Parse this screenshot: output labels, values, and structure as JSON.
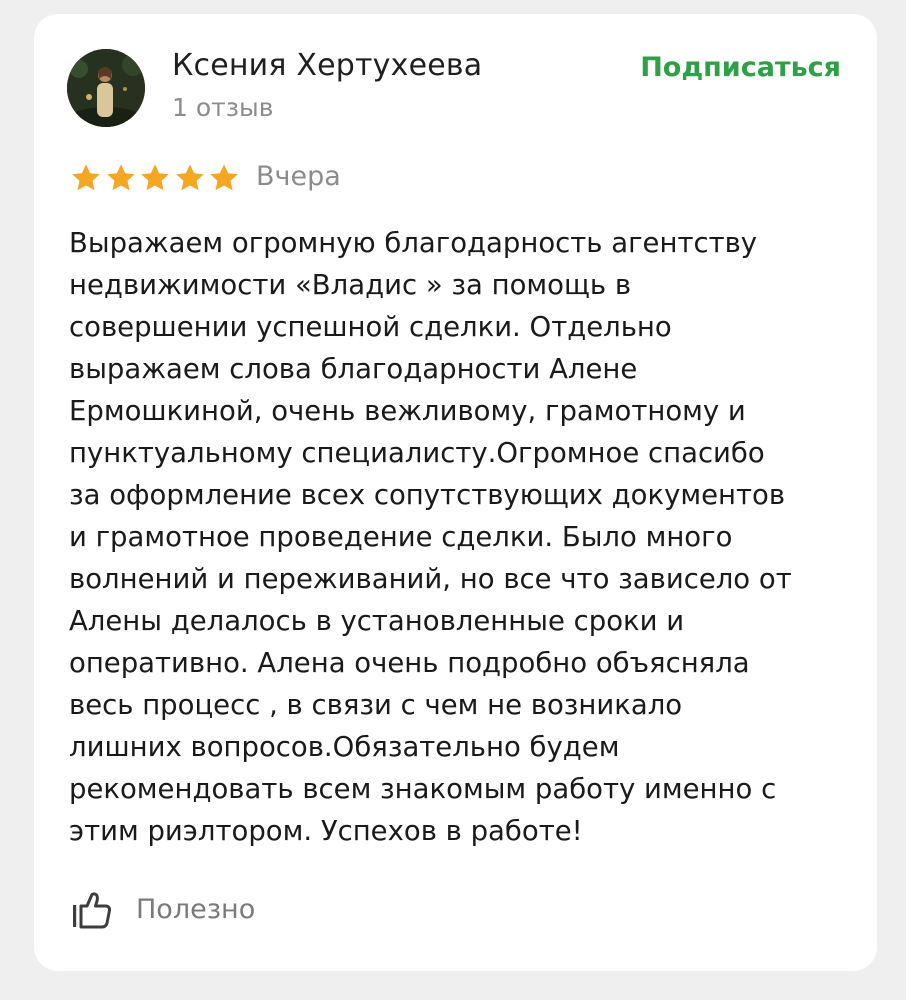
{
  "review": {
    "author": {
      "name": "Ксения Хертухеева",
      "review_count": "1 отзыв",
      "avatar_icon": "user-avatar-photo"
    },
    "subscribe_label": "Подписаться",
    "rating": {
      "value": 5,
      "max": 5,
      "star_color": "#f5a623"
    },
    "date": "Вчера",
    "text_lines": [
      "Выражаем огромную благодарность агентству",
      "недвижимости «Владис » за помощь в",
      "совершении успешной сделки. Отдельно",
      "выражаем слова благодарности Алене",
      "Ермошкиной, очень вежливому, грамотному и",
      "пунктуальному специалисту.Огромное спасибо",
      "за оформление всех сопутствующих документов",
      "и грамотное проведение сделки. Было много",
      "волнений и переживаний, но все что зависело от",
      "Алены делалось в установленные сроки и",
      "оперативно. Алена очень подробно объясняла",
      "весь процесс , в связи с чем не возникало",
      "лишних вопросов.Обязательно будем",
      "рекомендовать всем знакомым работу именно с",
      "этим риэлтором. Успехов в работе!"
    ],
    "helpful": {
      "label": "Полезно",
      "icon": "thumbs-up-icon"
    }
  },
  "colors": {
    "accent_green": "#2ea046",
    "muted_text": "#8c8c8c",
    "background": "#efefef",
    "card": "#ffffff"
  }
}
